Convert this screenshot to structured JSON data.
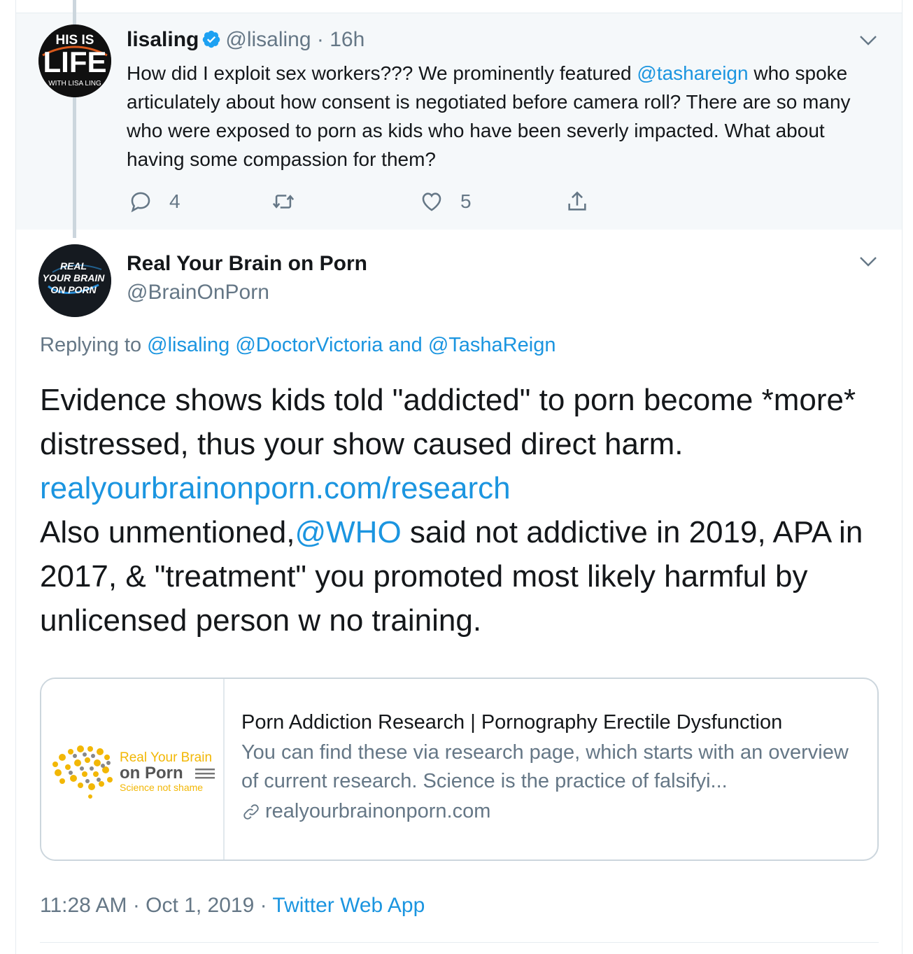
{
  "parent_tweet": {
    "avatar_text": {
      "line1": "HIS IS",
      "line2": "LIFE",
      "line3": "WITH LISA LING"
    },
    "name": "lisaling",
    "handle": "@lisaling",
    "time": "· 16h",
    "text_before": "How did I exploit sex workers??? We prominently featured ",
    "mention": "@tashareign",
    "text_after": " who spoke articulately about how consent is negotiated before camera roll? There are so many who were exposed to porn as kids who have been severly impacted. What about having some compassion for them?",
    "reply_count": "4",
    "retweet_count": "",
    "like_count": "5"
  },
  "main_tweet": {
    "avatar_text": {
      "line1": "REAL",
      "line2": "YOUR BRAIN",
      "line3": "ON PORN"
    },
    "name": "Real Your Brain on Porn",
    "handle": "@BrainOnPorn",
    "replying_prefix": "Replying to ",
    "replying_user1": "@lisaling",
    "replying_user2": "@DoctorVictoria",
    "replying_and": " and ",
    "replying_user3": "@TashaReign",
    "text_line1": "Evidence shows kids told \"addicted\" to porn become *more* distressed, thus your show caused direct harm.",
    "link": "realyourbrainonporn.com/research",
    "text_line2_prefix": "Also unmentioned,",
    "mention": "@WHO",
    "text_line2_suffix": " said not addictive in 2019, APA in 2017, & \"treatment\" you promoted most likely harmful by unlicensed person w no training.",
    "timestamp": "11:28 AM · Oct 1, 2019 · ",
    "source": "Twitter Web App"
  },
  "card": {
    "logo_line1": "Real Your Brain",
    "logo_line2": "on Porn",
    "logo_tagline": "Science not shame",
    "title": "Porn Addiction Research | Pornography Erectile Dysfunction",
    "description": "You can find these via research page, which starts with an overview of current research. Science is the practice of falsifyi...",
    "domain": "realyourbrainonporn.com"
  },
  "colors": {
    "link": "#1b95e0",
    "muted": "#657786",
    "parent_bg": "#f5f8fa",
    "brand_yellow": "#f2b705"
  },
  "icons": [
    "verified-badge-icon",
    "chevron-down-icon",
    "reply-icon",
    "retweet-icon",
    "like-icon",
    "share-icon",
    "link-icon"
  ]
}
